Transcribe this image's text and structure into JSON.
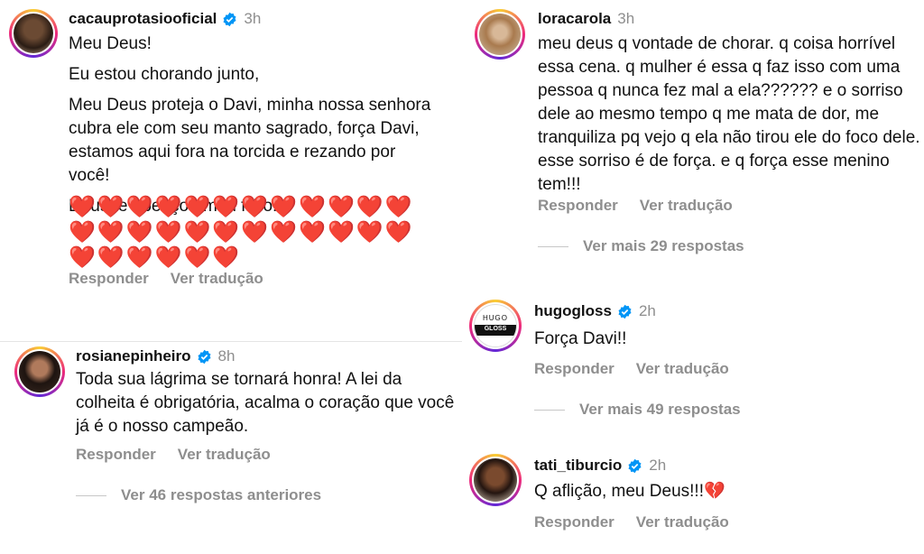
{
  "colors": {
    "text": "#111111",
    "muted": "#8e8e8e",
    "verified": "#0095f6",
    "heart": "#e0122f"
  },
  "comments": [
    {
      "username": "cacauprotasiooficial",
      "verified": true,
      "time": "3h",
      "paragraphs": [
        "Meu Deus!",
        "Eu estou chorando junto,",
        "Meu Deus proteja o Davi, minha nossa senhora cubra ele com seu manto sagrado, força Davi, estamos aqui fora na torcida e rezando por você!",
        "Deus te abençoe meu filho!"
      ],
      "hearts": "❤️❤️❤️❤️❤️❤️❤️❤️❤️❤️❤️❤️❤️❤️❤️❤️❤️❤️❤️❤️❤️❤️❤️❤️❤️❤️❤️❤️❤️❤️",
      "reply": "Responder",
      "translate": "Ver tradução"
    },
    {
      "username": "rosianepinheiro",
      "verified": true,
      "time": "8h",
      "paragraphs": [
        "Toda sua lágrima se tornará honra! A lei da colheita é obrigatória, acalma o coração que você já é o nosso campeão."
      ],
      "reply": "Responder",
      "translate": "Ver tradução",
      "more": "Ver 46 respostas anteriores"
    },
    {
      "username": "loracarola",
      "verified": false,
      "time": "3h",
      "paragraphs": [
        "meu deus q vontade de chorar. q coisa horrível essa cena. q mulher é essa q faz isso com uma pessoa q nunca fez mal a ela?????? e o sorriso dele ao mesmo tempo q me mata de dor, me tranquiliza pq vejo q ela não tirou ele do foco dele. esse sorriso é de força. e q força esse menino tem!!!"
      ],
      "reply": "Responder",
      "translate": "Ver tradução",
      "more": "Ver mais 29 respostas"
    },
    {
      "username": "hugogloss",
      "verified": true,
      "time": "2h",
      "avatar_text_top": "HUGO",
      "avatar_text_bottom": "GLOSS",
      "paragraphs": [
        "Força Davi!!"
      ],
      "reply": "Responder",
      "translate": "Ver tradução",
      "more": "Ver mais 49 respostas"
    },
    {
      "username": "tati_tiburcio",
      "verified": true,
      "time": "2h",
      "paragraphs": [
        "Q aflição,  meu Deus!!!💔"
      ],
      "reply": "Responder",
      "translate": "Ver tradução"
    }
  ]
}
